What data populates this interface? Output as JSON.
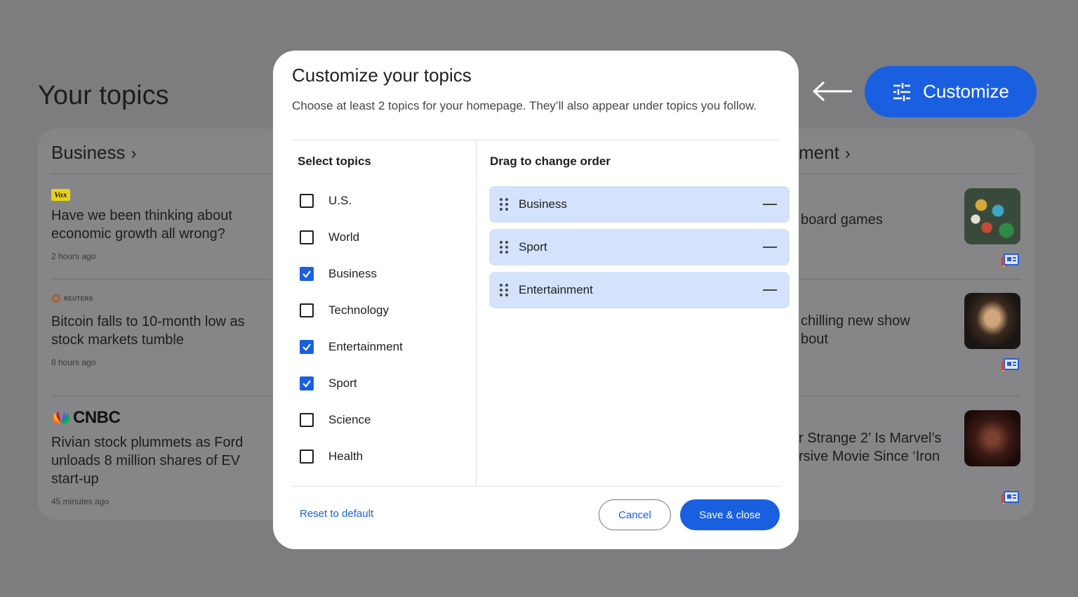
{
  "background": {
    "page_title": "Your topics",
    "left_section": {
      "title": "Business",
      "articles": [
        {
          "source": "Vox",
          "headline": "Have we been thinking about economic growth all wrong?",
          "time": "2 hours ago"
        },
        {
          "source": "REUTERS",
          "headline": "Bitcoin falls to 10-month low as stock markets tumble",
          "time": "8 hours ago"
        },
        {
          "source": "CNBC",
          "headline": "Rivian stock plummets as Ford unloads 8 million shares of EV start-up",
          "time": "45 minutes ago"
        }
      ]
    },
    "right_section": {
      "title_fragment": "ment",
      "articles": [
        {
          "headline_line1": "board games",
          "headline_line2": ""
        },
        {
          "headline_line1": "chilling new show",
          "headline_line2": "bout"
        },
        {
          "headline_line1": "r Strange 2’ Is Marvel’s",
          "headline_line2": "rsive Movie Since ‘Iron"
        }
      ]
    },
    "customize_button_label": "Customize"
  },
  "dialog": {
    "title": "Customize your topics",
    "subtitle": "Choose at least 2 topics for your homepage. They’ll also appear under topics you follow.",
    "select_heading": "Select topics",
    "order_heading": "Drag to change order",
    "topics": [
      {
        "label": "U.S.",
        "checked": false
      },
      {
        "label": "World",
        "checked": false
      },
      {
        "label": "Business",
        "checked": true
      },
      {
        "label": "Technology",
        "checked": false
      },
      {
        "label": "Entertainment",
        "checked": true
      },
      {
        "label": "Sport",
        "checked": true
      },
      {
        "label": "Science",
        "checked": false
      },
      {
        "label": "Health",
        "checked": false
      }
    ],
    "order": [
      "Business",
      "Sport",
      "Entertainment"
    ],
    "reset_label": "Reset to default",
    "cancel_label": "Cancel",
    "save_label": "Save & close"
  },
  "colors": {
    "accent": "#1a5fe0",
    "chip_bg": "#d4e2fb",
    "scrim": "#7d7d80"
  }
}
